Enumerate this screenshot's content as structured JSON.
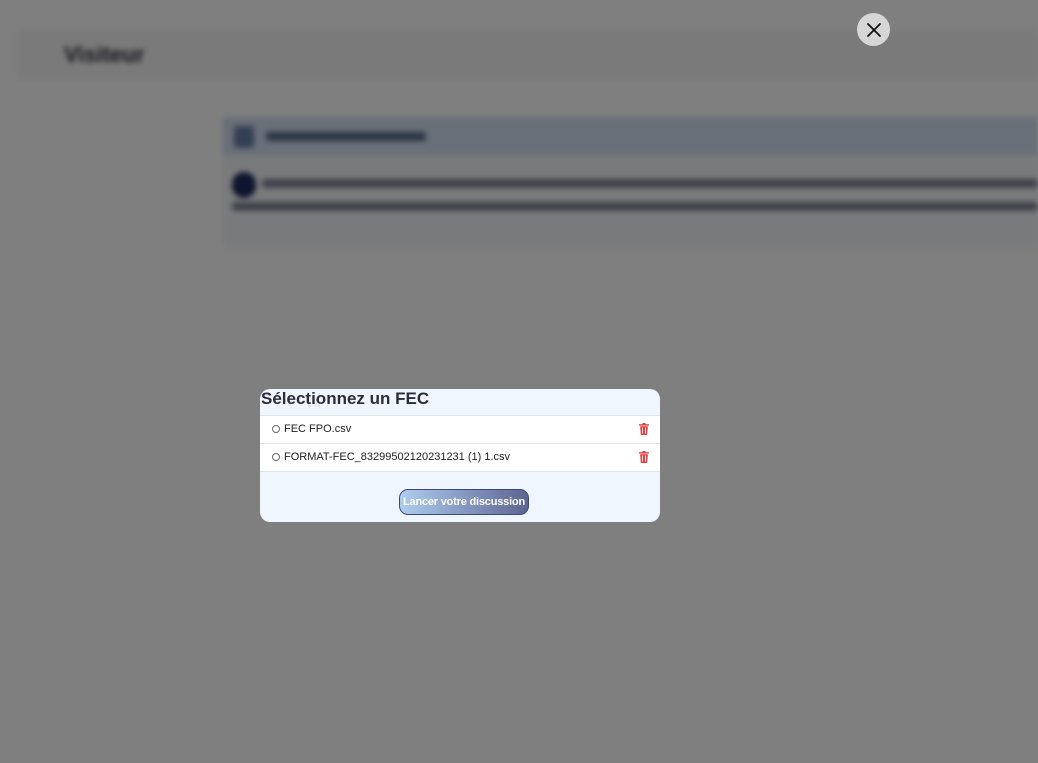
{
  "background": {
    "header_title": "Visiteur"
  },
  "modal": {
    "title": "Sélectionnez un FEC",
    "files": [
      {
        "name": "FEC FPO.csv",
        "selected": false
      },
      {
        "name": "FORMAT-FEC_83299502120231231 (1) 1.csv",
        "selected": false
      }
    ],
    "launch_label": "Lancer votre discussion"
  },
  "icons": {
    "close": "close-icon",
    "delete": "trash-icon"
  },
  "colors": {
    "delete_icon": "#e03e3e",
    "modal_background": "#f0f6fd",
    "overlay": "#7f7f7f"
  }
}
